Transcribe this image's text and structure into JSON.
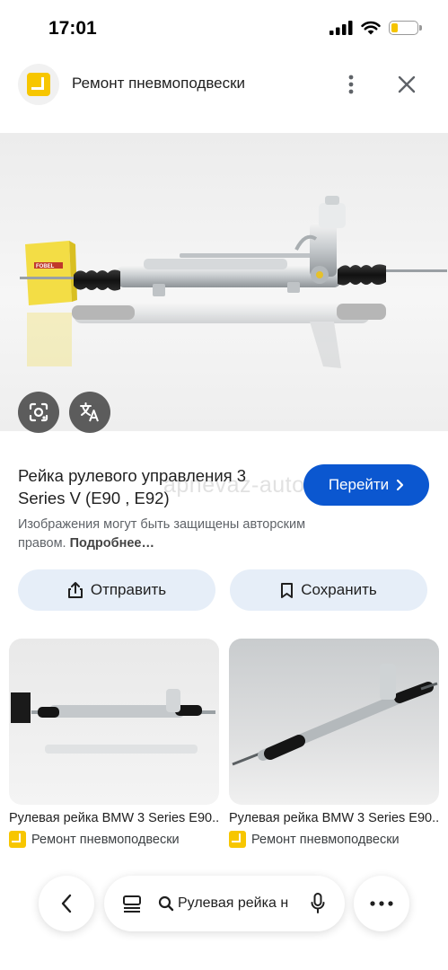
{
  "status_bar": {
    "time": "17:01"
  },
  "header": {
    "title": "Ремонт пневмоподвески",
    "more_icon": "more-vert-icon",
    "close_icon": "close-icon"
  },
  "image": {
    "watermark": "apnevaz-auto.ru",
    "box_brand": "FOBEL",
    "lens_icon": "google-lens-icon",
    "translate_icon": "translate-icon"
  },
  "result": {
    "title": "Рейка рулевого управления 3 Series V (E90 , E92)",
    "goto_label": "Перейти",
    "copyright_text": "Изображения могут быть защищены авторским правом.",
    "copyright_link": "Подробнее…"
  },
  "actions": {
    "share_label": "Отправить",
    "save_label": "Сохранить"
  },
  "related": [
    {
      "title": "Рулевая рейка BMW 3 Series E90...",
      "source": "Ремонт пневмоподвески"
    },
    {
      "title": "Рулевая рейка BMW 3 Series E90...",
      "source": "Ремонт пневмоподвески"
    }
  ],
  "bottom_bar": {
    "search_text": "Рулевая рейка н"
  },
  "colors": {
    "accent": "#0b57d0",
    "pill_bg": "#e6eef8",
    "brand_yellow": "#f7c600"
  }
}
